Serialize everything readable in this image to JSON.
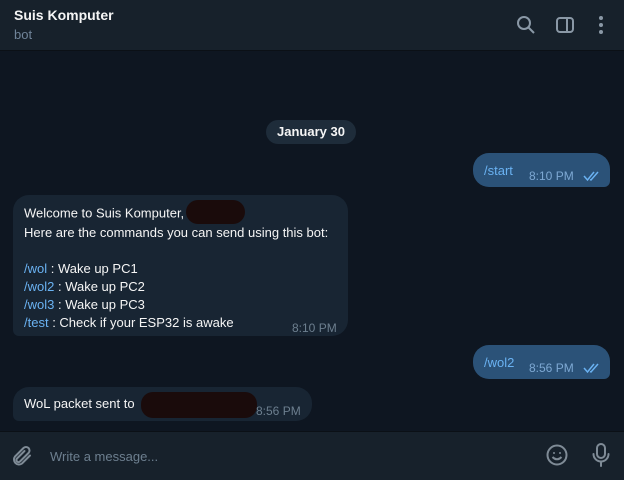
{
  "header": {
    "title": "Suis Komputer",
    "subtitle": "bot",
    "icons": [
      "search-icon",
      "sidebar-toggle-icon",
      "more-vertical-icon"
    ]
  },
  "chat": {
    "date_label": "January 30",
    "messages": [
      {
        "direction": "outgoing",
        "text": "/start",
        "time": "8:10 PM",
        "status": "read"
      },
      {
        "direction": "incoming",
        "greeting": "Welcome to Suis Komputer,",
        "intro": "Here are the commands you can send using this bot:",
        "commands": [
          {
            "cmd": "/wol",
            "desc": " : Wake up PC1"
          },
          {
            "cmd": "/wol2",
            "desc": " : Wake up PC2"
          },
          {
            "cmd": "/wol3",
            "desc": " : Wake up PC3"
          },
          {
            "cmd": "/test",
            "desc": " : Check if your ESP32 is awake"
          }
        ],
        "time": "8:10 PM"
      },
      {
        "direction": "outgoing",
        "text": "/wol2",
        "time": "8:56 PM",
        "status": "read"
      },
      {
        "direction": "incoming",
        "text": "WoL packet sent to",
        "time": "8:56 PM"
      }
    ]
  },
  "composer": {
    "placeholder": "Write a message...",
    "icons": [
      "paperclip-icon",
      "emoji-icon",
      "microphone-icon"
    ]
  },
  "colors": {
    "background": "#0e1621",
    "panel": "#17212b",
    "outgoing_bubble": "#2b5278",
    "incoming_bubble": "#182533",
    "link": "#6ab2f2",
    "redaction": "#1a0b0b"
  }
}
